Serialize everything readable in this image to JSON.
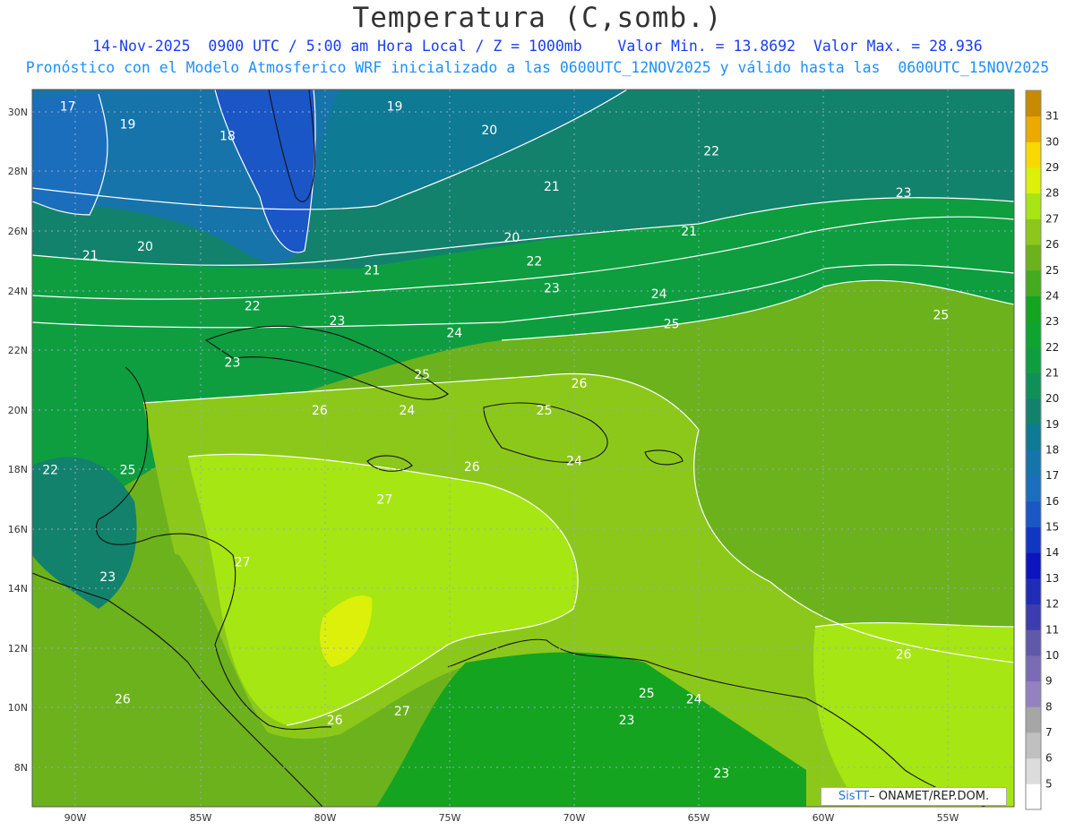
{
  "title": "Temperatura (C,somb.)",
  "subtitle_line1": "14-Nov-2025  0900 UTC / 5:00 am Hora Local / Z = 1000mb    Valor Min. = 13.8692  Valor Max. = 28.936",
  "subtitle_line2": "Pronóstico con el Modelo Atmosferico WRF inicializado a las 0600UTC_12NOV2025 y válido hasta las  0600UTC_15NOV2025",
  "credit": {
    "brand": "SisTT",
    "org": "– ONAMET/REP.DOM."
  },
  "axes": {
    "lon_labels": [
      "90W",
      "85W",
      "80W",
      "75W",
      "70W",
      "65W",
      "60W",
      "55W"
    ],
    "lat_labels": [
      "8N",
      "10N",
      "12N",
      "14N",
      "16N",
      "18N",
      "20N",
      "22N",
      "24N",
      "26N",
      "28N",
      "30N"
    ]
  },
  "colorbar": {
    "levels": [
      5,
      6,
      7,
      8,
      9,
      10,
      11,
      12,
      13,
      14,
      15,
      16,
      17,
      18,
      19,
      20,
      21,
      22,
      23,
      24,
      25,
      26,
      27,
      28,
      29,
      30,
      31
    ],
    "colors": [
      "#ffffff",
      "#dcdcdc",
      "#c0c0c0",
      "#a6a6a6",
      "#9482c0",
      "#7a6bb4",
      "#6058a8",
      "#3c3cae",
      "#1e2cb8",
      "#0c14c0",
      "#1236c4",
      "#1a56c6",
      "#1a6ebc",
      "#1674aa",
      "#0e7a94",
      "#12826c",
      "#109058",
      "#0e9e40",
      "#0ea430",
      "#14a420",
      "#44aa20",
      "#6cb21c",
      "#8cc81a",
      "#a6e612",
      "#dcf00a",
      "#f8d800",
      "#ecaa00",
      "#c88a00"
    ]
  },
  "contour_labels": [
    {
      "text": "17",
      "lon": -90.3,
      "lat": 30.2
    },
    {
      "text": "19",
      "lon": -87.9,
      "lat": 29.6
    },
    {
      "text": "18",
      "lon": -83.9,
      "lat": 29.2
    },
    {
      "text": "19",
      "lon": -77.2,
      "lat": 30.2
    },
    {
      "text": "20",
      "lon": -73.4,
      "lat": 29.4
    },
    {
      "text": "22",
      "lon": -64.5,
      "lat": 28.7
    },
    {
      "text": "21",
      "lon": -70.9,
      "lat": 27.5
    },
    {
      "text": "23",
      "lon": -56.8,
      "lat": 27.3
    },
    {
      "text": "21",
      "lon": -65.4,
      "lat": 26.0
    },
    {
      "text": "20",
      "lon": -72.5,
      "lat": 25.8
    },
    {
      "text": "20",
      "lon": -87.2,
      "lat": 25.5
    },
    {
      "text": "21",
      "lon": -89.4,
      "lat": 25.2
    },
    {
      "text": "22",
      "lon": -71.6,
      "lat": 25.0
    },
    {
      "text": "21",
      "lon": -78.1,
      "lat": 24.7
    },
    {
      "text": "23",
      "lon": -70.9,
      "lat": 24.1
    },
    {
      "text": "24",
      "lon": -66.6,
      "lat": 23.9
    },
    {
      "text": "22",
      "lon": -82.9,
      "lat": 23.5
    },
    {
      "text": "25",
      "lon": -55.3,
      "lat": 23.2
    },
    {
      "text": "23",
      "lon": -79.5,
      "lat": 23.0
    },
    {
      "text": "25",
      "lon": -66.1,
      "lat": 22.9
    },
    {
      "text": "24",
      "lon": -74.8,
      "lat": 22.6
    },
    {
      "text": "23",
      "lon": -83.7,
      "lat": 21.6
    },
    {
      "text": "25",
      "lon": -76.1,
      "lat": 21.2
    },
    {
      "text": "26",
      "lon": -69.8,
      "lat": 20.9
    },
    {
      "text": "26",
      "lon": -80.2,
      "lat": 20.0
    },
    {
      "text": "24",
      "lon": -76.7,
      "lat": 20.0
    },
    {
      "text": "25",
      "lon": -71.2,
      "lat": 20.0
    },
    {
      "text": "25",
      "lon": -87.9,
      "lat": 18.0
    },
    {
      "text": "22",
      "lon": -91.0,
      "lat": 18.0
    },
    {
      "text": "24",
      "lon": -70.0,
      "lat": 18.3
    },
    {
      "text": "26",
      "lon": -74.1,
      "lat": 18.1
    },
    {
      "text": "27",
      "lon": -77.6,
      "lat": 17.0
    },
    {
      "text": "27",
      "lon": -83.3,
      "lat": 14.9
    },
    {
      "text": "23",
      "lon": -88.7,
      "lat": 14.4
    },
    {
      "text": "26",
      "lon": -56.8,
      "lat": 11.8
    },
    {
      "text": "26",
      "lon": -88.1,
      "lat": 10.3
    },
    {
      "text": "25",
      "lon": -67.1,
      "lat": 10.5
    },
    {
      "text": "24",
      "lon": -65.2,
      "lat": 10.3
    },
    {
      "text": "27",
      "lon": -76.9,
      "lat": 9.9
    },
    {
      "text": "26",
      "lon": -79.6,
      "lat": 9.6
    },
    {
      "text": "23",
      "lon": -67.9,
      "lat": 9.6
    },
    {
      "text": "23",
      "lon": -64.1,
      "lat": 7.8
    }
  ]
}
